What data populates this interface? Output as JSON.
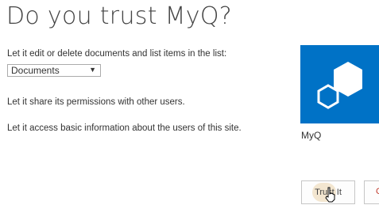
{
  "dialog": {
    "title": "Do you trust MyQ?",
    "edit_label": "Let it edit or delete documents and list items in the list:",
    "list_select": {
      "value": "Documents",
      "options": [
        "Documents"
      ]
    },
    "share_label": "Let it share its permissions with other users.",
    "access_label": "Let it access basic information about the users of this site."
  },
  "app": {
    "name": "MyQ",
    "icon": "cubes-icon",
    "tile_color": "#0072c6"
  },
  "buttons": {
    "trust_label": "Trust It",
    "cancel_label": "C"
  }
}
